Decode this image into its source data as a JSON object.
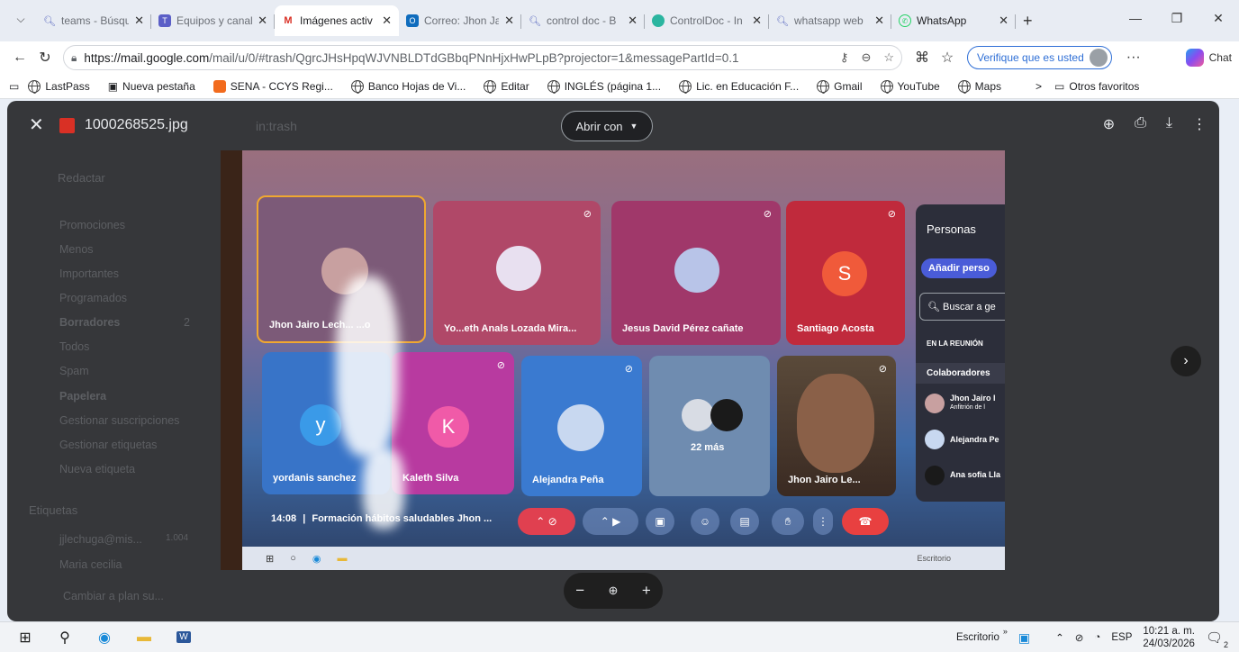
{
  "browser": {
    "tabs": [
      {
        "title": "teams - Búsque",
        "icon": "search-icon",
        "active": false
      },
      {
        "title": "Equipos y canal",
        "icon": "teams-icon",
        "active": false
      },
      {
        "title": "Imágenes activ",
        "icon": "gmail-icon",
        "active": true
      },
      {
        "title": "Correo: Jhon Ja",
        "icon": "outlook-icon",
        "active": false
      },
      {
        "title": "control doc - B",
        "icon": "search-icon",
        "active": false
      },
      {
        "title": "ControlDoc - In",
        "icon": "controldoc-icon",
        "active": false
      },
      {
        "title": "whatsapp web",
        "icon": "search-icon",
        "active": false
      },
      {
        "title": "WhatsApp",
        "icon": "whatsapp-icon",
        "active": false
      }
    ],
    "url_host": "https://mail.google.com",
    "url_path": "/mail/u/0/#trash/QgrcJHsHpqWJVNBLDTdGBbqPNnHjxHwPLpB?projector=1&messagePartId=0.1",
    "verify_label": "Verifique que es usted",
    "chat_label": "Chat",
    "more": "···",
    "bookmarks": [
      "LastPass",
      "Nueva pestaña",
      "SENA - CCYS Regi...",
      "Banco Hojas de Vi...",
      "Editar",
      "INGLÉS (página 1...",
      "Lic. en Educación F...",
      "Gmail",
      "YouTube",
      "Maps"
    ],
    "bookmarks_overflow": ">",
    "other_favorites": "Otros favoritos"
  },
  "viewer": {
    "filename": "1000268525.jpg",
    "open_with": "Abrir con",
    "search_ghost": "in:trash",
    "gmail_ghost": {
      "compose": "Redactar",
      "labels_title": "Etiquetas",
      "nav": [
        "Promociones",
        "Menos",
        "Importantes",
        "Programados",
        "Borradores",
        "Todos",
        "Spam",
        "Papelera",
        "Gestionar suscripciones",
        "Gestionar etiquetas",
        "Nueva etiqueta"
      ],
      "drafts_count": "2",
      "user_labels": [
        "jjlechuga@mis...",
        "Maria cecilia"
      ],
      "label_count": "1.004",
      "upgrade": "Cambiar a plan su..."
    }
  },
  "photo": {
    "tiles": [
      {
        "name": "Jhon Jairo Lech... ...o"
      },
      {
        "name": "Yo...eth Anals Lozada Mira..."
      },
      {
        "name": "Jesus David Pérez cañate"
      },
      {
        "name": "Santiago Acosta",
        "initial": "S"
      },
      {
        "name": "yordanis sanchez",
        "initial": "y"
      },
      {
        "name": "Kaleth Silva",
        "initial": "K"
      },
      {
        "name": "Alejandra Peña"
      },
      {
        "name": "22 más"
      },
      {
        "name": "Jhon Jairo Le..."
      }
    ],
    "people_panel": {
      "title": "Personas",
      "add": "Añadir perso",
      "search": "Buscar a ge",
      "section": "EN LA REUNIÓN",
      "group": "Colaboradores",
      "members": [
        {
          "name": "Jhon Jairo l",
          "role": "Anfitrión de l"
        },
        {
          "name": "Alejandra Pe",
          "role": ""
        },
        {
          "name": "Ana sofia Lla",
          "role": ""
        }
      ]
    },
    "meeting": {
      "time": "14:08",
      "sep": "|",
      "title": "Formación hábitos saludables Jhon ..."
    },
    "desktop_search": "Escritorio"
  },
  "taskbar": {
    "desktop": "Escritorio",
    "chevron": "»",
    "lang": "ESP",
    "time": "10:21 a. m.",
    "date": "24/03/2026",
    "notif": "2"
  }
}
